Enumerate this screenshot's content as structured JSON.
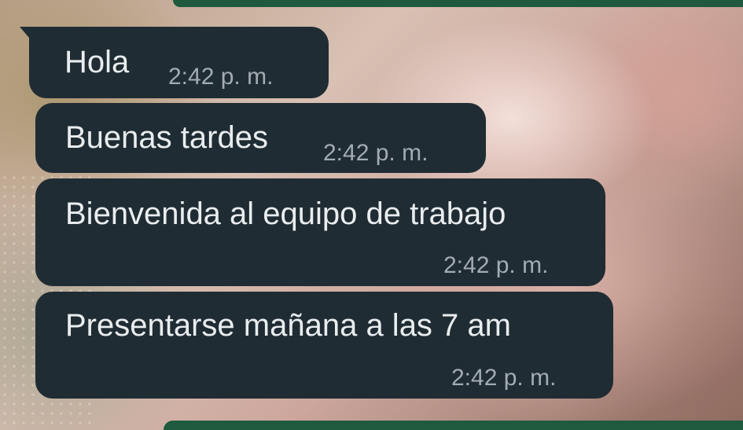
{
  "chat": {
    "messages": [
      {
        "text": "Hola",
        "time": "2:42 p. m."
      },
      {
        "text": "Buenas tardes",
        "time": "2:42 p. m."
      },
      {
        "text": "Bienvenida al equipo de trabajo",
        "time": "2:42 p. m."
      },
      {
        "text": "Presentarse mañana a las 7 am",
        "time": "2:42 p. m."
      }
    ]
  },
  "colors": {
    "bubble_background": "#202c33",
    "message_text": "#e9edef",
    "timestamp_text": "#a3acb1",
    "accent_green": "#1f5a3f"
  }
}
